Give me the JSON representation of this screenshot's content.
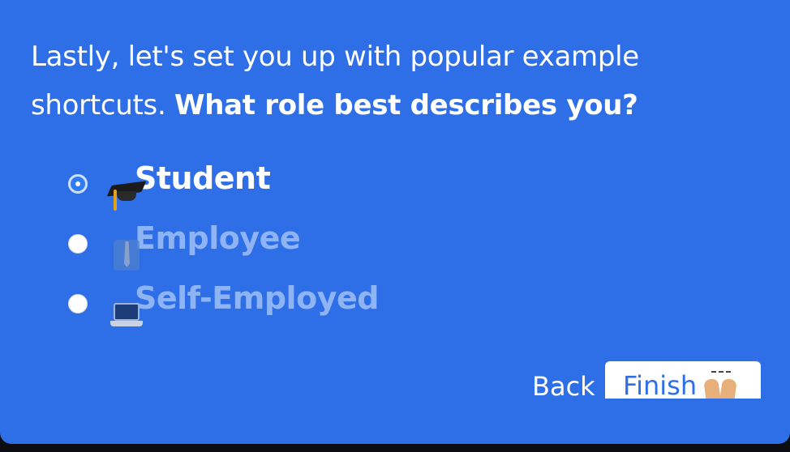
{
  "dialog": {
    "intro_text": "Lastly, let's set you up with popular example shortcuts.",
    "question_text": "What role best describes you?",
    "accent_color": "#2e6fe8",
    "roles": [
      {
        "label": "Student",
        "icon": "graduation-cap-icon",
        "selected": true
      },
      {
        "label": "Employee",
        "icon": "necktie-shirt-icon",
        "selected": false
      },
      {
        "label": "Self-Employed",
        "icon": "laptop-icon",
        "selected": false
      }
    ],
    "buttons": {
      "back_label": "Back",
      "finish_label": "Finish",
      "finish_icon": "raising-hands-icon"
    }
  }
}
